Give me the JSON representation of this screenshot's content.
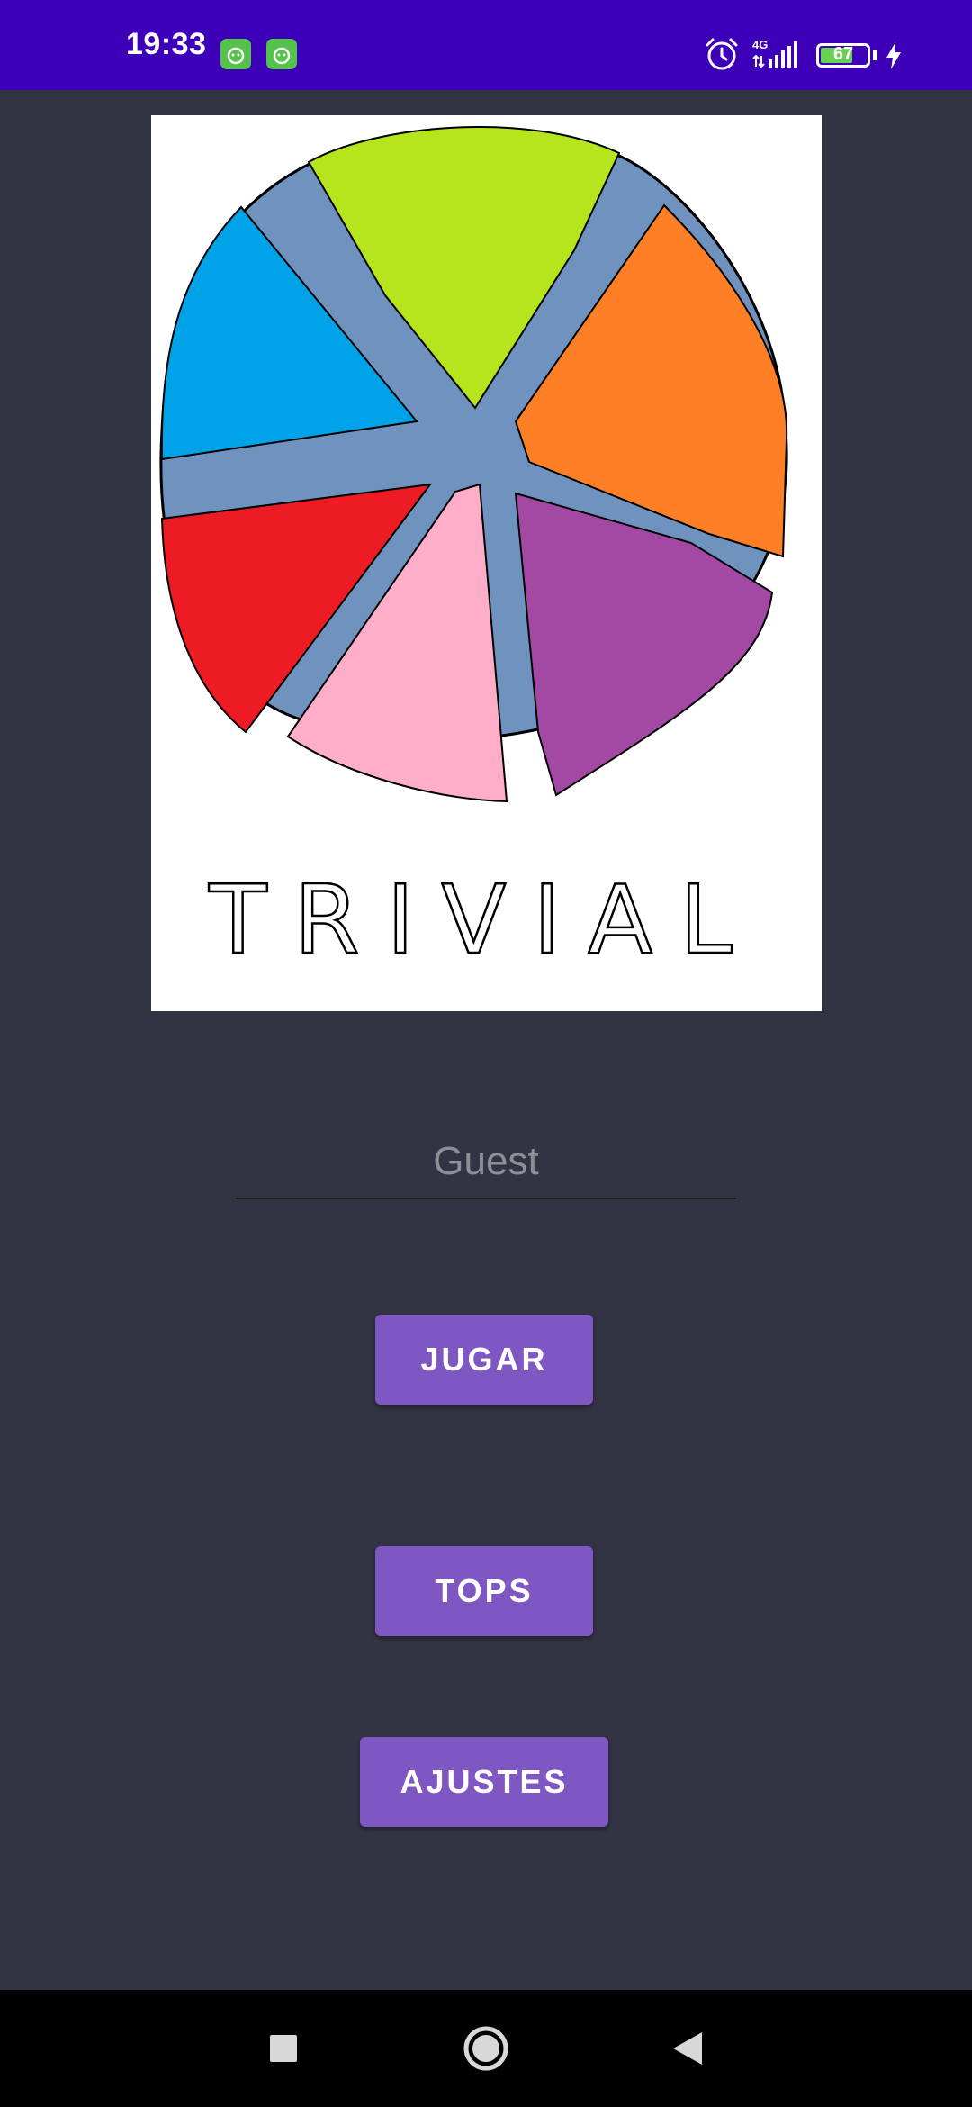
{
  "status_bar": {
    "time": "19:33",
    "network": "4G",
    "battery_level": "67",
    "notification_icons": [
      "app-notification-icon",
      "app-notification-icon"
    ],
    "system_icons": [
      "alarm-icon",
      "signal-icon",
      "battery-icon",
      "charging-icon"
    ],
    "background_color": "#3d00b8"
  },
  "logo": {
    "text": "TRIVIAL",
    "wedge_colors": [
      "#b5e51d",
      "#ff7f27",
      "#a349a4",
      "#ffaec9",
      "#ed1c24",
      "#00a2e8"
    ],
    "spoke_color": "#7092be"
  },
  "name_input": {
    "value": "",
    "placeholder": "Guest"
  },
  "buttons": {
    "play_label": "JUGAR",
    "tops_label": "TOPS",
    "settings_label": "AJUSTES"
  },
  "colors": {
    "background": "#323343",
    "button": "#7e57c2"
  },
  "nav_bar": {
    "icons": [
      "recents-square-icon",
      "home-circle-icon",
      "back-triangle-icon"
    ]
  }
}
